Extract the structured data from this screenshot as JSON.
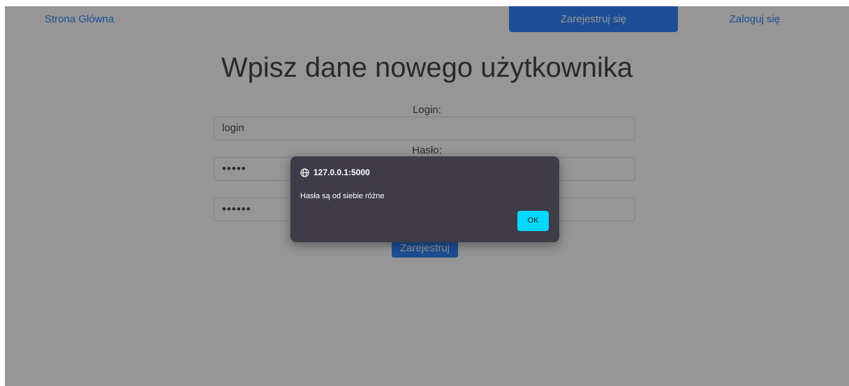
{
  "nav": {
    "home": "Strona Główna",
    "register": "Zarejestruj się",
    "login": "Zaloguj się"
  },
  "form": {
    "title": "Wpisz dane nowego użytkownika",
    "login_label": "Login:",
    "login_value": "login",
    "password_label": "Hasło:",
    "password_value": "•••••",
    "password_confirm_value": "••••••",
    "submit_label": "Zarejestruj"
  },
  "dialog": {
    "origin": "127.0.0.1:5000",
    "message": "Hasła są od siebie różne",
    "ok_label": "OK",
    "icon": "globe-icon"
  },
  "colors": {
    "primary": "#0d6efd",
    "dialog_bg": "#3f3c48",
    "ok_button": "#00d8ff"
  }
}
